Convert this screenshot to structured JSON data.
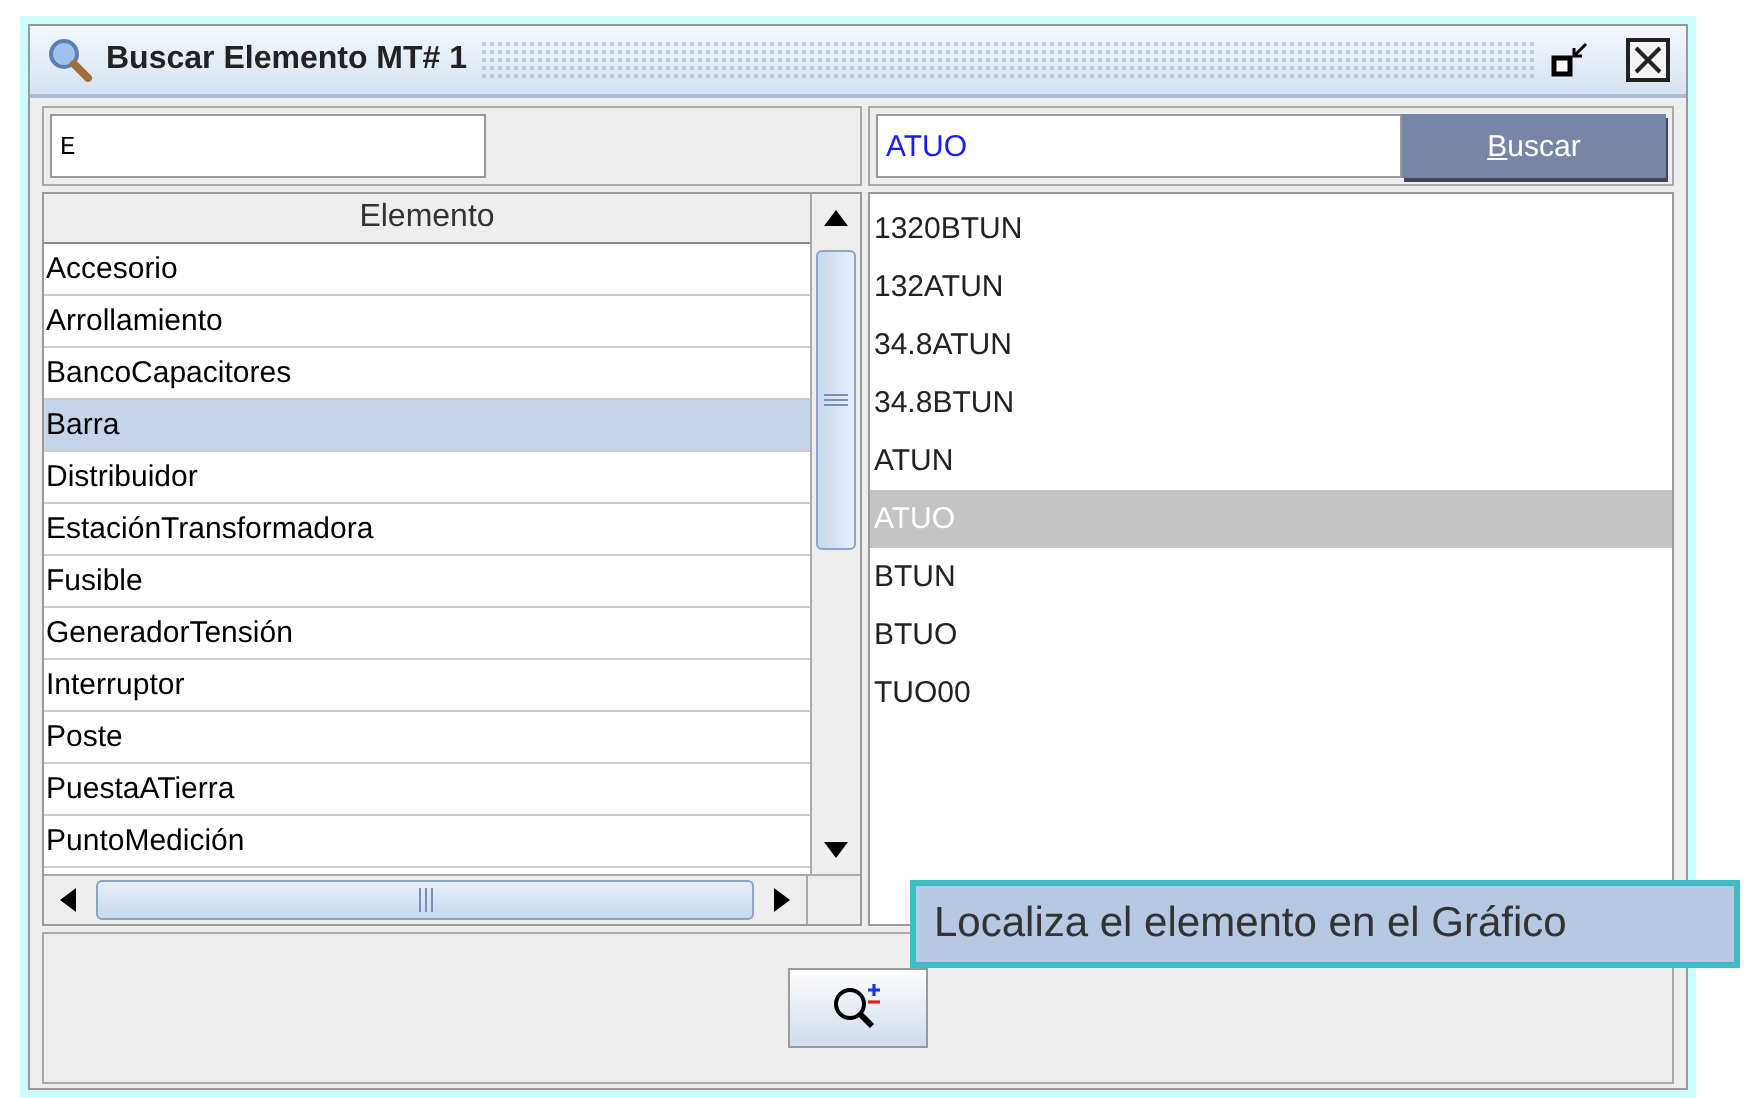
{
  "window": {
    "title": "Buscar Elemento MT# 1"
  },
  "filter_field": {
    "value": "E"
  },
  "search_field": {
    "value": "ATUO"
  },
  "search_button": {
    "label": "Buscar"
  },
  "element_table": {
    "column": "Elemento",
    "rows": [
      {
        "label": "Accesorio",
        "selected": false
      },
      {
        "label": "Arrollamiento",
        "selected": false
      },
      {
        "label": "BancoCapacitores",
        "selected": false
      },
      {
        "label": "Barra",
        "selected": true
      },
      {
        "label": "Distribuidor",
        "selected": false
      },
      {
        "label": "EstaciónTransformadora",
        "selected": false
      },
      {
        "label": "Fusible",
        "selected": false
      },
      {
        "label": "GeneradorTensión",
        "selected": false
      },
      {
        "label": "Interruptor",
        "selected": false
      },
      {
        "label": "Poste",
        "selected": false
      },
      {
        "label": "PuestaATierra",
        "selected": false
      },
      {
        "label": "PuntoMedición",
        "selected": false
      }
    ]
  },
  "result_list": [
    {
      "label": "1320BTUN",
      "selected": false
    },
    {
      "label": "132ATUN",
      "selected": false
    },
    {
      "label": "34.8ATUN",
      "selected": false
    },
    {
      "label": "34.8BTUN",
      "selected": false
    },
    {
      "label": "ATUN",
      "selected": false
    },
    {
      "label": "ATUO",
      "selected": true
    },
    {
      "label": "BTUN",
      "selected": false
    },
    {
      "label": "BTUO",
      "selected": false
    },
    {
      "label": "TUO00",
      "selected": false
    }
  ],
  "tooltip": "Localiza el elemento en el Gráfico"
}
